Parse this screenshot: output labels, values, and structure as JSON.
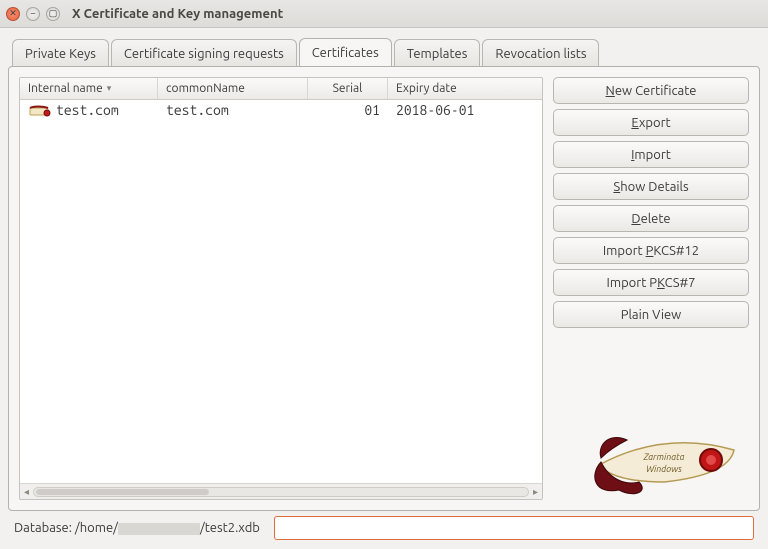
{
  "window": {
    "title": "X Certificate and Key management"
  },
  "tabs": [
    {
      "label": "Private Keys",
      "active": false
    },
    {
      "label": "Certificate signing requests",
      "active": false
    },
    {
      "label": "Certificates",
      "active": true
    },
    {
      "label": "Templates",
      "active": false
    },
    {
      "label": "Revocation lists",
      "active": false
    }
  ],
  "columns": {
    "internal_name": "Internal name",
    "common_name": "commonName",
    "serial": "Serial",
    "expiry": "Expiry date"
  },
  "rows": [
    {
      "internal_name": "test.com",
      "common_name": "test.com",
      "serial": "01",
      "expiry": "2018-06-01"
    }
  ],
  "buttons": {
    "new_certificate": "New Certificate",
    "export": "Export",
    "import": "Import",
    "show_details": "Show Details",
    "delete": "Delete",
    "import_pkcs12": "Import PKCS#12",
    "import_pkcs7": "Import PKCS#7",
    "plain_view": "Plain View"
  },
  "status": {
    "prefix": "Database: /home/",
    "suffix": "/test2.xdb",
    "input_value": ""
  }
}
